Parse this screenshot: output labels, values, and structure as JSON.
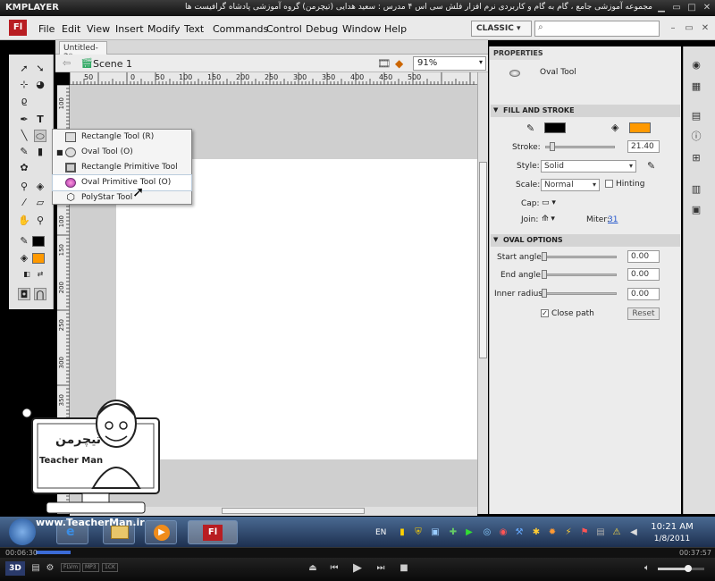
{
  "player": {
    "app_name": "KMPLAYER",
    "caption": "مجموعه آموزشی جامع ، گام به گام و کاربردی نرم افزار فلش سی اس ۴ مدرس : سعید هدایی (تیچرمن) گروه آموزشی پادشاه گرافیست ها",
    "time_elapsed": "00:06:30",
    "time_total": "00:37:57",
    "progress_fraction": 0.17,
    "formats": [
      "FLVm",
      "MP3",
      "1CK"
    ],
    "mode": "3D"
  },
  "flash": {
    "logo": "Fl",
    "menu": [
      "File",
      "Edit",
      "View",
      "Insert",
      "Modify",
      "Text",
      "Commands",
      "Control",
      "Debug",
      "Window",
      "Help"
    ],
    "workspace": "CLASSIC",
    "doc_tab": "Untitled-2*",
    "scene": "Scene 1",
    "zoom": "91%",
    "ruler_h": [
      "50",
      "0",
      "50",
      "100",
      "150",
      "200",
      "250",
      "300",
      "350",
      "400",
      "450",
      "500"
    ],
    "ruler_v": [
      "100",
      "50",
      "0",
      "50",
      "100",
      "150",
      "200",
      "250",
      "300",
      "350",
      "400"
    ],
    "flyout": [
      {
        "label": "Rectangle Tool (R)",
        "checked": false
      },
      {
        "label": "Oval Tool (O)",
        "checked": true
      },
      {
        "label": "Rectangle Primitive Tool (R)",
        "checked": false
      },
      {
        "label": "Oval Primitive Tool (O)",
        "checked": false,
        "hover": true
      },
      {
        "label": "PolyStar Tool",
        "checked": false
      }
    ]
  },
  "properties": {
    "tab": "PROPERTIES",
    "tool_name": "Oval Tool",
    "fill_stroke": {
      "title": "FILL AND STROKE",
      "stroke_color": "#000000",
      "fill_color": "#ff9900",
      "stroke_label": "Stroke:",
      "stroke_value": "21.40",
      "style_label": "Style:",
      "style_value": "Solid",
      "scale_label": "Scale:",
      "scale_value": "Normal",
      "hinting_label": "Hinting",
      "cap_label": "Cap:",
      "join_label": "Join:",
      "miter_label": "Miter:",
      "miter_value": "31"
    },
    "oval_options": {
      "title": "OVAL OPTIONS",
      "start_label": "Start angle:",
      "start_value": "0.00",
      "end_label": "End angle:",
      "end_value": "0.00",
      "inner_label": "Inner radius:",
      "inner_value": "0.00",
      "close_path_label": "Close path",
      "close_path_checked": true,
      "reset_label": "Reset"
    }
  },
  "taskbar": {
    "lang": "EN",
    "time": "10:21 AM",
    "date": "1/8/2011",
    "active_app": "Fl"
  },
  "watermark": {
    "url": "www.TeacherMan.ir",
    "brand": "Teacher Man",
    "tag": "تیچرمن"
  }
}
